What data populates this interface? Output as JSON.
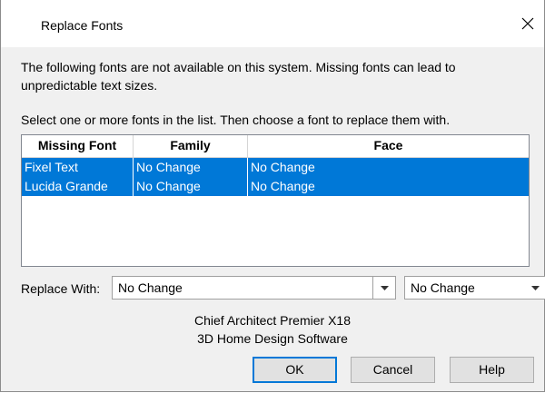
{
  "window": {
    "title": "Replace Fonts"
  },
  "message": {
    "line1": "The following fonts are not available on this system. Missing fonts can lead to unpredictable text sizes.",
    "line2": "Select one or more fonts in the list.  Then choose a font to replace them with."
  },
  "table": {
    "columns": [
      "Missing Font",
      "Family",
      "Face"
    ],
    "rows": [
      {
        "missing_font": "Fixel Text",
        "family": "No Change",
        "face": "No Change",
        "selected": true
      },
      {
        "missing_font": "Lucida Grande",
        "family": "No Change",
        "face": "No Change",
        "selected": true
      }
    ]
  },
  "replace": {
    "label": "Replace With:",
    "family_value": "No Change",
    "face_value": "No Change"
  },
  "info": {
    "line1": "Chief Architect Premier X18",
    "line2": "3D Home Design Software"
  },
  "buttons": {
    "ok": "OK",
    "cancel": "Cancel",
    "help": "Help"
  },
  "colors": {
    "selection": "#0078d7",
    "default_button_border": "#0078d7"
  },
  "icons": {
    "close": "close-icon",
    "dropdown": "chevron-down-icon"
  }
}
